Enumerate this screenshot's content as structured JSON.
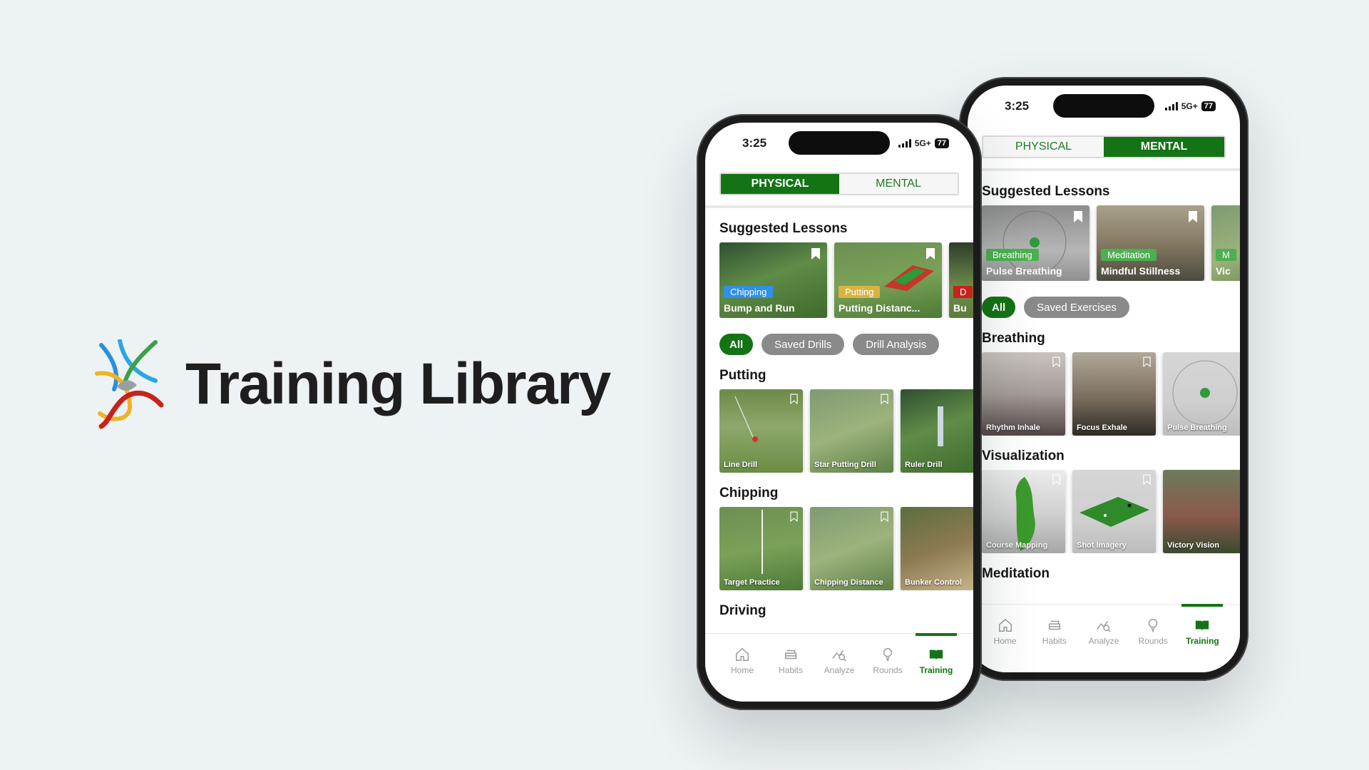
{
  "hero": {
    "title": "Training Library"
  },
  "phone1": {
    "time": "3:25",
    "network": "5G+",
    "battery": "77",
    "tabs": [
      "PHYSICAL",
      "MENTAL"
    ],
    "active_tab": "PHYSICAL",
    "suggested_heading": "Suggested Lessons",
    "lessons": [
      {
        "tag": "Chipping",
        "tag_color": "#2f8fea",
        "title": "Bump and Run"
      },
      {
        "tag": "Putting",
        "tag_color": "#d9b341",
        "title": "Putting Distanc..."
      },
      {
        "tag": "D",
        "tag_color": "#c8221c",
        "title": "Bu"
      }
    ],
    "chips": [
      "All",
      "Saved Drills",
      "Drill Analysis"
    ],
    "sections": [
      {
        "heading": "Putting",
        "drills": [
          "Line Drill",
          "Star Putting Drill",
          "Ruler Drill"
        ]
      },
      {
        "heading": "Chipping",
        "drills": [
          "Target Practice",
          "Chipping Distance",
          "Bunker Control"
        ]
      },
      {
        "heading": "Driving",
        "drills": []
      }
    ],
    "nav": [
      "Home",
      "Habits",
      "Analyze",
      "Rounds",
      "Training"
    ],
    "active_nav": "Training"
  },
  "phone2": {
    "time": "3:25",
    "network": "5G+",
    "battery": "77",
    "tabs": [
      "PHYSICAL",
      "MENTAL"
    ],
    "active_tab": "MENTAL",
    "suggested_heading": "Suggested Lessons",
    "lessons": [
      {
        "tag": "Breathing",
        "tag_color": "#4caf50",
        "title": "Pulse Breathing"
      },
      {
        "tag": "Meditation",
        "tag_color": "#4caf50",
        "title": "Mindful Stillness"
      },
      {
        "tag": "M",
        "tag_color": "#4caf50",
        "title": "Vic"
      }
    ],
    "chips": [
      "All",
      "Saved Exercises"
    ],
    "sections": [
      {
        "heading": "Breathing",
        "drills": [
          "Rhythm Inhale",
          "Focus Exhale",
          "Pulse Breathing"
        ]
      },
      {
        "heading": "Visualization",
        "drills": [
          "Course Mapping",
          "Shot Imagery",
          "Victory Vision"
        ]
      },
      {
        "heading": "Meditation",
        "drills": []
      }
    ],
    "nav": [
      "Home",
      "Habits",
      "Analyze",
      "Rounds",
      "Training"
    ],
    "active_nav": "Training"
  },
  "colors": {
    "brand_green": "#137315",
    "chip_grey": "#8a8a8a",
    "background": "#edf2f4"
  }
}
